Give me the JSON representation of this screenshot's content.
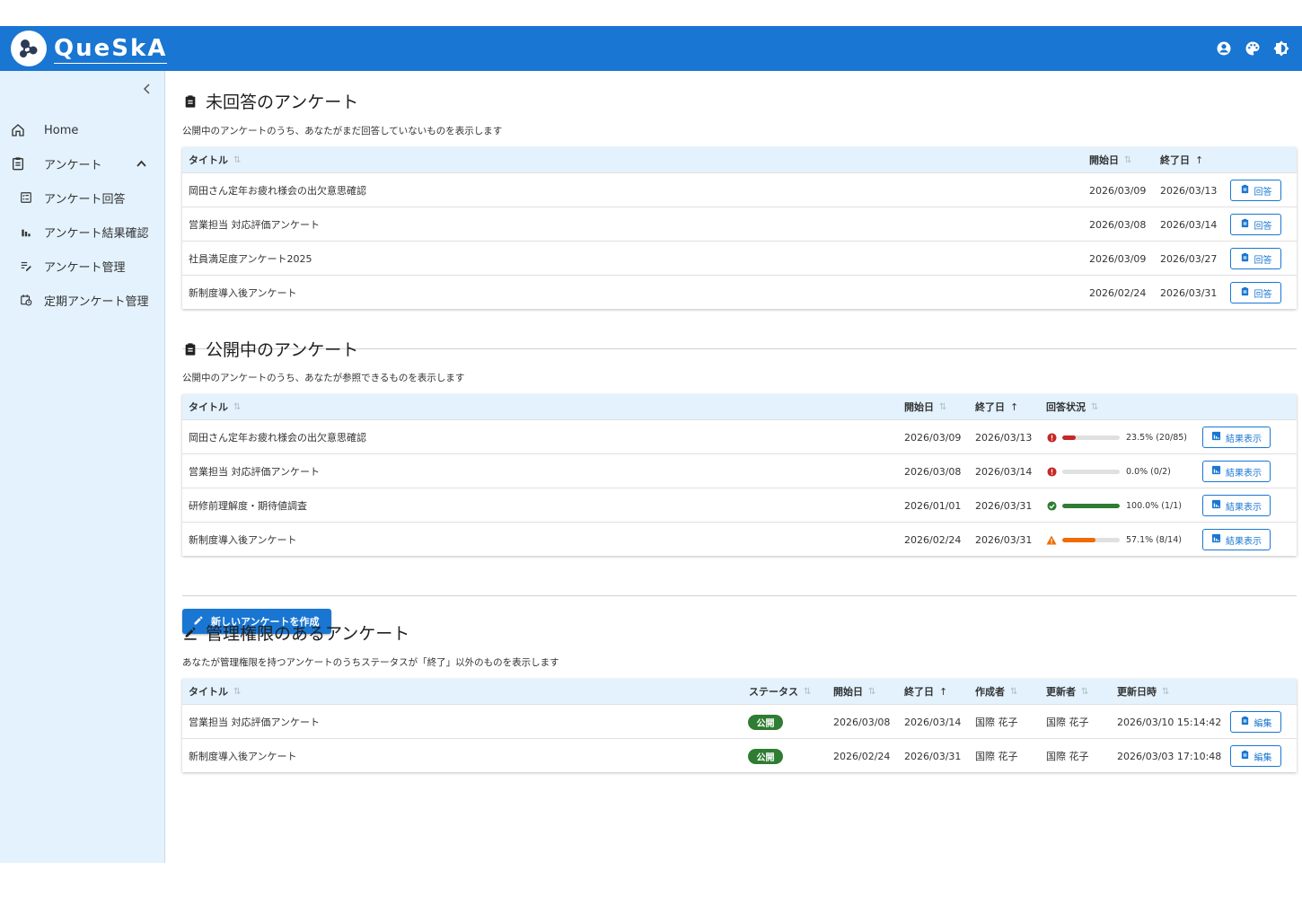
{
  "app": {
    "title": "QueSkA"
  },
  "topbar": {
    "icons": [
      "account-circle-icon",
      "palette-icon",
      "theme-toggle-icon"
    ]
  },
  "sidebar": {
    "items": [
      {
        "label": "Home",
        "icon": "home-icon"
      },
      {
        "label": "アンケート",
        "icon": "clipboard-icon"
      },
      {
        "label": "アンケート回答",
        "icon": "form-icon"
      },
      {
        "label": "アンケート結果確認",
        "icon": "bar-chart-icon"
      },
      {
        "label": "アンケート管理",
        "icon": "edit-list-icon"
      },
      {
        "label": "定期アンケート管理",
        "icon": "calendar-clock-icon"
      }
    ]
  },
  "unanswered": {
    "title": "未回答のアンケート",
    "desc": "公開中のアンケートのうち、あなたがまだ回答していないものを表示します",
    "headers": {
      "title": "タイトル",
      "start": "開始日",
      "end": "終了日"
    },
    "rows": [
      {
        "title": "岡田さん定年お疲れ様会の出欠意思確認",
        "start": "2026/03/09",
        "end": "2026/03/13",
        "action": "回答"
      },
      {
        "title": "営業担当 対応評価アンケート",
        "start": "2026/03/08",
        "end": "2026/03/14",
        "action": "回答"
      },
      {
        "title": "社員満足度アンケート2025",
        "start": "2026/03/09",
        "end": "2026/03/27",
        "action": "回答"
      },
      {
        "title": "新制度導入後アンケート",
        "start": "2026/02/24",
        "end": "2026/03/31",
        "action": "回答"
      }
    ]
  },
  "published": {
    "title": "公開中のアンケート",
    "desc": "公開中のアンケートのうち、あなたが参照できるものを表示します",
    "headers": {
      "title": "タイトル",
      "start": "開始日",
      "end": "終了日",
      "status": "回答状況"
    },
    "rows": [
      {
        "title": "岡田さん定年お疲れ様会の出欠意思確認",
        "start": "2026/03/09",
        "end": "2026/03/13",
        "progress": 0.235,
        "pct_text": "23.5% (20/85)",
        "state": "error",
        "color": "#c62828",
        "action": "結果表示"
      },
      {
        "title": "営業担当 対応評価アンケート",
        "start": "2026/03/08",
        "end": "2026/03/14",
        "progress": 0.0,
        "pct_text": "0.0% (0/2)",
        "state": "error",
        "color": "#c62828",
        "action": "結果表示"
      },
      {
        "title": "研修前理解度・期待値調査",
        "start": "2026/01/01",
        "end": "2026/03/31",
        "progress": 1.0,
        "pct_text": "100.0% (1/1)",
        "state": "ok",
        "color": "#2e7d32",
        "action": "結果表示"
      },
      {
        "title": "新制度導入後アンケート",
        "start": "2026/02/24",
        "end": "2026/03/31",
        "progress": 0.571,
        "pct_text": "57.1% (8/14)",
        "state": "warn",
        "color": "#ef6c00",
        "action": "結果表示"
      }
    ]
  },
  "new_button": {
    "label": "新しいアンケートを作成"
  },
  "managed": {
    "title": "管理権限のあるアンケート",
    "desc": "あなたが管理権限を持つアンケートのうちステータスが「終了」以外のものを表示します",
    "headers": {
      "title": "タイトル",
      "status": "ステータス",
      "start": "開始日",
      "end": "終了日",
      "creator": "作成者",
      "updater": "更新者",
      "updated": "更新日時"
    },
    "rows": [
      {
        "title": "営業担当 対応評価アンケート",
        "status": "公開",
        "start": "2026/03/08",
        "end": "2026/03/14",
        "creator": "国際 花子",
        "updater": "国際 花子",
        "updated": "2026/03/10 15:14:42",
        "action": "編集"
      },
      {
        "title": "新制度導入後アンケート",
        "status": "公開",
        "start": "2026/02/24",
        "end": "2026/03/31",
        "creator": "国際 花子",
        "updater": "国際 花子",
        "updated": "2026/03/03 17:10:48",
        "action": "編集"
      }
    ]
  }
}
